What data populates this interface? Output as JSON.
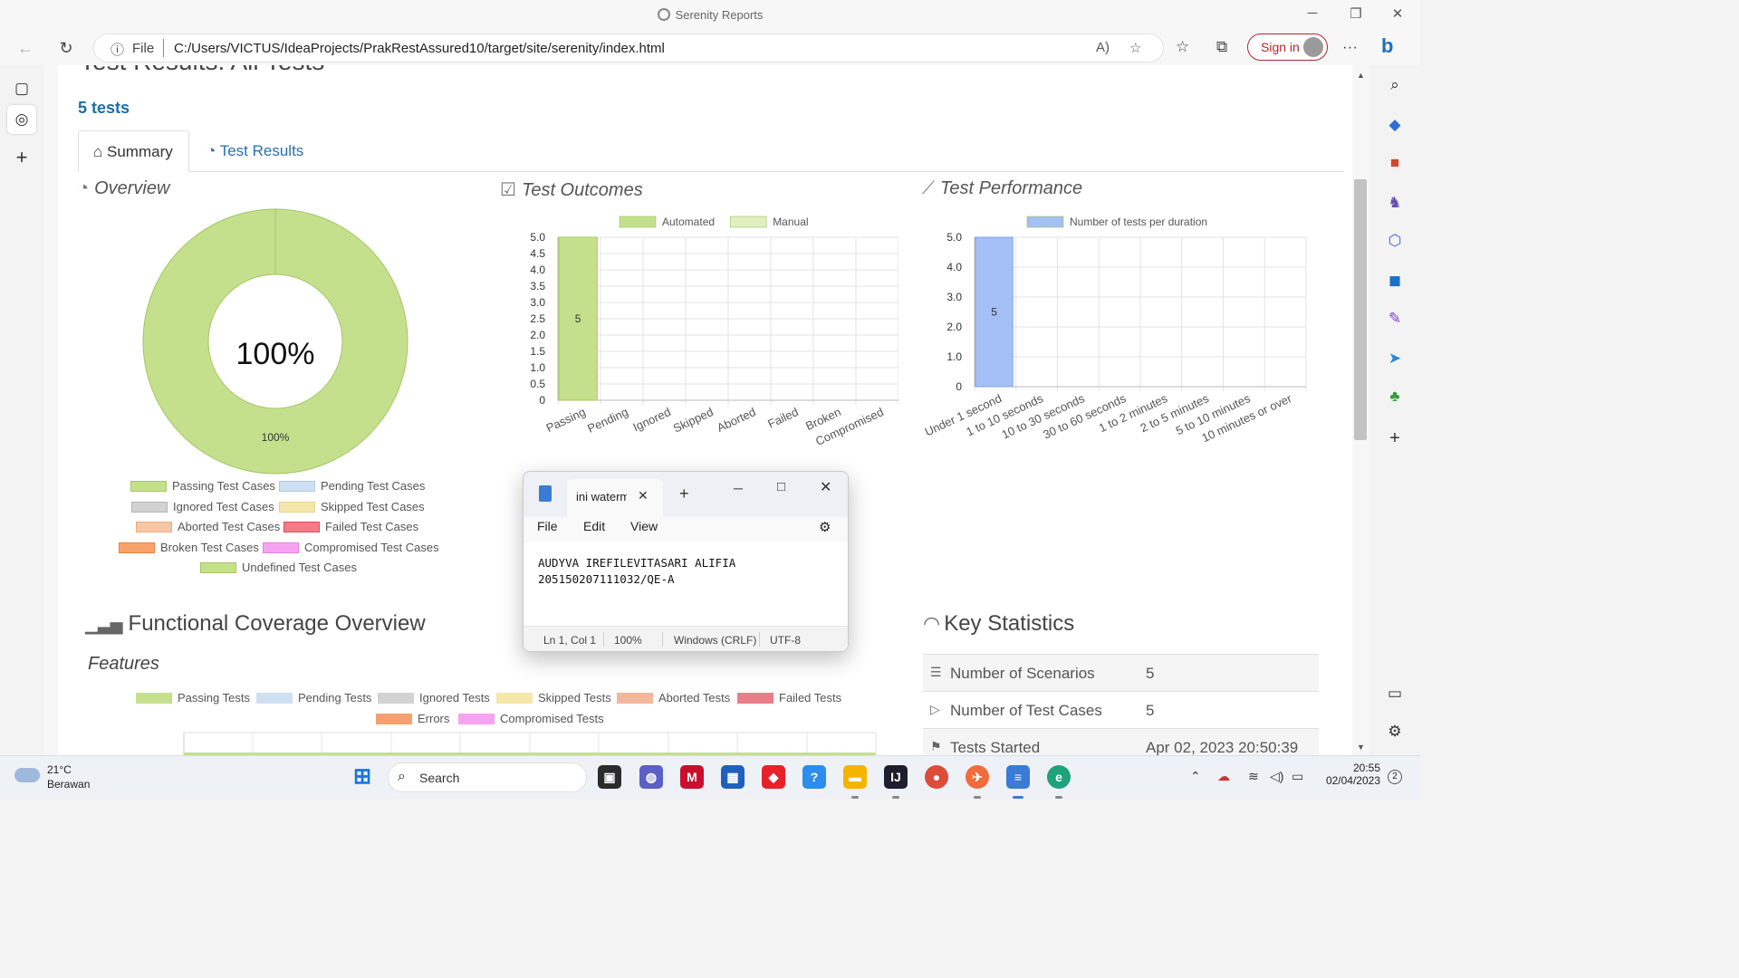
{
  "window": {
    "title": "Serenity Reports"
  },
  "browser": {
    "url_scheme": "File",
    "url": "C:/Users/VICTUS/IdeaProjects/PrakRestAssured10/target/site/serenity/index.html",
    "signin_label": "Sign in"
  },
  "report": {
    "cut_title": "Test Results: All Tests",
    "tests_count": "5 tests",
    "tabs": {
      "summary": "Summary",
      "results": "Test Results"
    },
    "overview": {
      "title": "Overview",
      "center_label": "100%",
      "slice_label": "100%",
      "legend": [
        "Passing Test Cases",
        "Pending Test Cases",
        "Ignored Test Cases",
        "Skipped Test Cases",
        "Aborted Test Cases",
        "Failed Test Cases",
        "Broken Test Cases",
        "Compromised Test Cases",
        "Undefined Test Cases"
      ],
      "colors": {
        "passing": "#c5e08c",
        "pending": "#cfe0f3",
        "ignored": "#d2d2d2",
        "skipped": "#f4e7a9",
        "aborted": "#f7c6a5",
        "failed": "#f47c87",
        "broken": "#f9a36b",
        "compromised": "#f7a3f2",
        "undefined": "#c5e08c"
      }
    },
    "outcomes": {
      "title": "Test Outcomes"
    },
    "performance": {
      "title": "Test Performance"
    },
    "functional": {
      "title": "Functional Coverage Overview",
      "features": "Features",
      "legend": [
        "Passing Tests",
        "Pending Tests",
        "Ignored Tests",
        "Skipped Tests",
        "Aborted Tests",
        "Failed Tests",
        "Errors",
        "Compromised Tests"
      ]
    },
    "key_stats": {
      "title": "Key Statistics",
      "rows": [
        {
          "label": "Number of Scenarios",
          "value": "5"
        },
        {
          "label": "Number of Test Cases",
          "value": "5"
        },
        {
          "label": "Tests Started",
          "value": "Apr 02, 2023 20:50:39"
        }
      ]
    }
  },
  "chart_data": [
    {
      "type": "pie",
      "title": "",
      "categories": [
        "Passing Test Cases"
      ],
      "values": [
        100
      ],
      "colors": [
        "#c5e08c"
      ]
    },
    {
      "type": "bar",
      "title": "",
      "categories": [
        "Passing",
        "Pending",
        "Ignored",
        "Skipped",
        "Aborted",
        "Failed",
        "Broken",
        "Compromised"
      ],
      "series": [
        {
          "name": "Automated",
          "values": [
            5,
            0,
            0,
            0,
            0,
            0,
            0,
            0
          ],
          "color": "#c5e08c"
        },
        {
          "name": "Manual",
          "values": [
            0,
            0,
            0,
            0,
            0,
            0,
            0,
            0
          ],
          "color": "#e0efc0"
        }
      ],
      "ylim": [
        0,
        5.0
      ],
      "yticks": [
        "0",
        "0.5",
        "1.0",
        "1.5",
        "2.0",
        "2.5",
        "3.0",
        "3.5",
        "4.0",
        "4.5",
        "5.0"
      ],
      "data_labels": [
        "5"
      ],
      "grid": true,
      "legend": "top"
    },
    {
      "type": "bar",
      "title": "",
      "categories": [
        "Under 1 second",
        "1 to 10 seconds",
        "10 to 30 seconds",
        "30 to 60 seconds",
        "1 to 2 minutes",
        "2 to 5 minutes",
        "5 to 10 minutes",
        "10 minutes or over"
      ],
      "series": [
        {
          "name": "Number of tests per duration",
          "values": [
            5,
            0,
            0,
            0,
            0,
            0,
            0,
            0
          ],
          "color": "#a4c0f4"
        }
      ],
      "ylim": [
        0,
        5.0
      ],
      "yticks": [
        "0",
        "1.0",
        "2.0",
        "3.0",
        "4.0",
        "5.0"
      ],
      "data_labels": [
        "5"
      ],
      "grid": true,
      "legend": "top"
    }
  ],
  "notepad": {
    "tab_title": "ini watermark",
    "menus": [
      "File",
      "Edit",
      "View"
    ],
    "lines": [
      "AUDYVA IREFILEVITASARI ALIFIA",
      "205150207111032/QE-A"
    ],
    "status": {
      "position": "Ln 1, Col 1",
      "zoom": "100%",
      "line_ending": "Windows (CRLF)",
      "encoding": "UTF-8"
    }
  },
  "taskbar": {
    "weather_temp": "21°C",
    "weather_desc": "Berawan",
    "search_label": "Search",
    "time": "20:55",
    "date": "02/04/2023",
    "notif_count": "2"
  }
}
